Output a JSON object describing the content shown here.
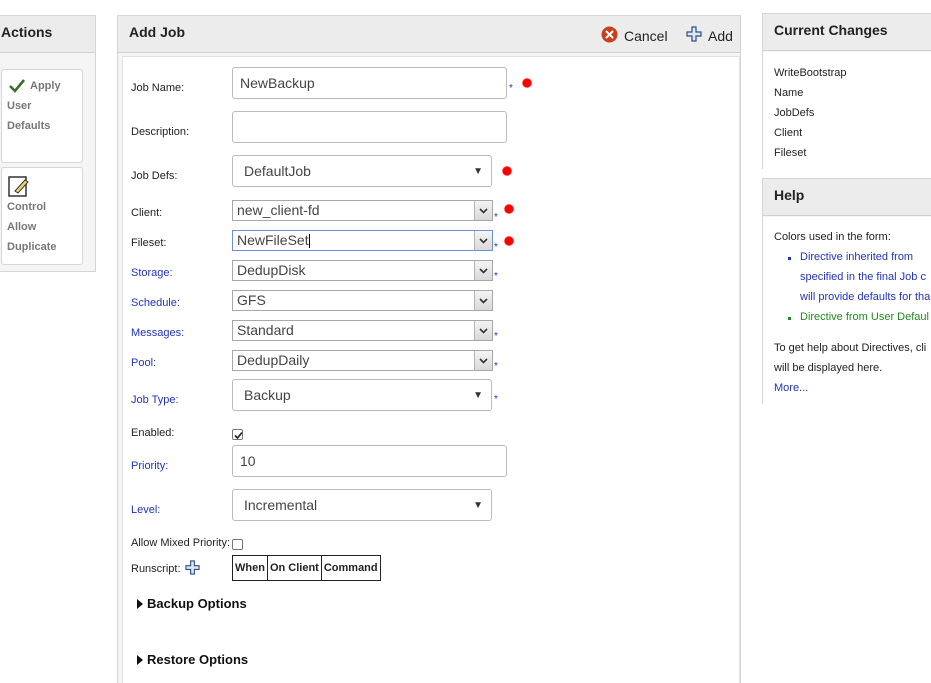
{
  "actions": {
    "title": "Actions",
    "apply_lines": [
      "Apply",
      "User",
      "Defaults"
    ],
    "control_lines": [
      "Control",
      "Allow",
      "Duplicate"
    ]
  },
  "main": {
    "title": "Add Job",
    "cancel_label": "Cancel",
    "add_label": "Add",
    "fields": {
      "job_name": {
        "label": "Job Name:",
        "value": "NewBackup"
      },
      "description": {
        "label": "Description:",
        "value": ""
      },
      "job_defs": {
        "label": "Job Defs:",
        "value": "DefaultJob"
      },
      "client": {
        "label": "Client:",
        "value": "new_client-fd"
      },
      "fileset": {
        "label": "Fileset:",
        "value": "NewFileSet"
      },
      "storage": {
        "label": "Storage:",
        "value": "DedupDisk"
      },
      "schedule": {
        "label": "Schedule:",
        "value": "GFS"
      },
      "messages": {
        "label": "Messages:",
        "value": "Standard"
      },
      "pool": {
        "label": "Pool:",
        "value": "DedupDaily"
      },
      "job_type": {
        "label": "Job Type:",
        "value": "Backup"
      },
      "enabled": {
        "label": "Enabled:",
        "checked": true
      },
      "priority": {
        "label": "Priority:",
        "value": "10"
      },
      "level": {
        "label": "Level:",
        "value": "Incremental"
      },
      "allow_mixed_priority": {
        "label": "Allow Mixed Priority:",
        "checked": false
      },
      "runscript": {
        "label": "Runscript:",
        "columns": [
          "When",
          "On Client",
          "Command"
        ]
      }
    },
    "required_mark": "*",
    "sections": [
      "Backup Options",
      "Restore Options"
    ]
  },
  "changes": {
    "title": "Current Changes",
    "items": [
      "WriteBootstrap",
      "Name",
      "JobDefs",
      "Client",
      "Fileset"
    ]
  },
  "help": {
    "title": "Help",
    "intro": "Colors used in the form:",
    "blue_lines": [
      "Directive   inherited   from",
      "specified in the final Job c",
      "will provide defaults for tha"
    ],
    "green_line": "Directive from User Defaul",
    "text_lines": [
      "To get help about Directives, cli",
      "will be displayed here."
    ],
    "more_link": "More...",
    "colors": {
      "inherited": "#2233bb",
      "user_default": "#228822"
    }
  }
}
